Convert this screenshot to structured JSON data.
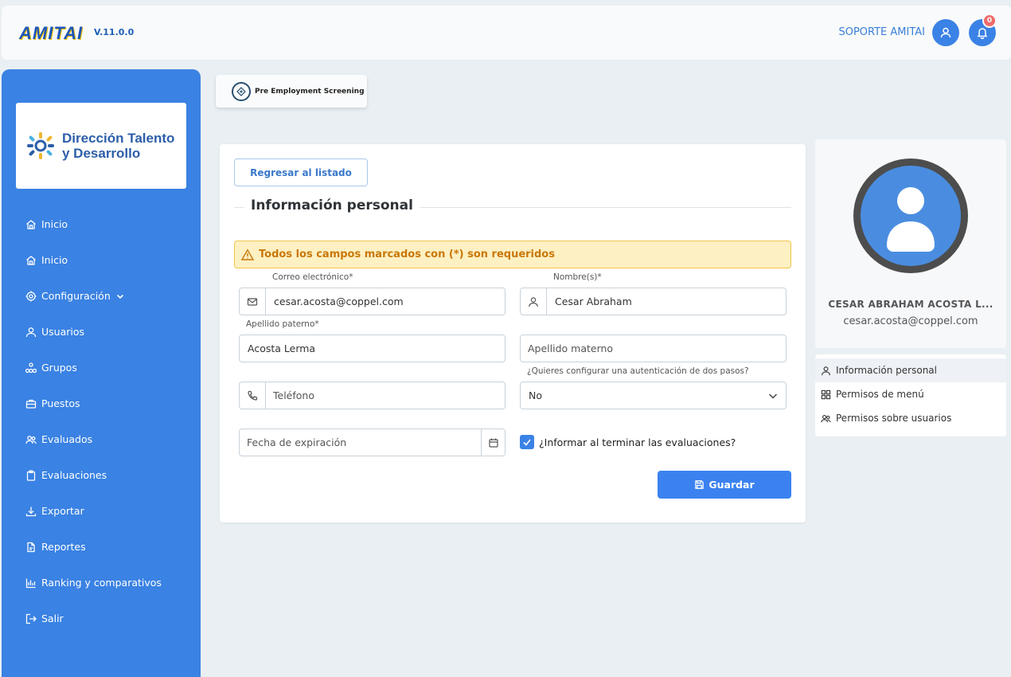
{
  "header": {
    "brand": "AMITAI",
    "version": "V.11.0.0",
    "support_label": "SOPORTE AMITAI",
    "notification_count": "0"
  },
  "sidebar": {
    "org_name_line1": "Dirección Talento",
    "org_name_line2": "y Desarrollo",
    "items": [
      {
        "label": "Inicio",
        "icon": "home-icon"
      },
      {
        "label": "Inicio",
        "icon": "home-icon"
      },
      {
        "label": "Configuración",
        "icon": "gear-icon"
      },
      {
        "label": "Usuarios",
        "icon": "user-icon"
      },
      {
        "label": "Grupos",
        "icon": "sitemap-icon"
      },
      {
        "label": "Puestos",
        "icon": "briefcase-icon"
      },
      {
        "label": "Evaluados",
        "icon": "users-icon"
      },
      {
        "label": "Evaluaciones",
        "icon": "clipboard-icon"
      },
      {
        "label": "Exportar",
        "icon": "download-icon"
      },
      {
        "label": "Reportes",
        "icon": "file-icon"
      },
      {
        "label": "Ranking y comparativos",
        "icon": "bar-chart-icon"
      },
      {
        "label": "Salir",
        "icon": "logout-icon"
      }
    ]
  },
  "module": {
    "label": "Pre Employment Screening"
  },
  "form": {
    "back_label": "Regresar al listado",
    "section_title": "Información personal",
    "alert": "Todos los campos marcados con (*) son requeridos",
    "email_label": "Correo electrónico*",
    "email_value": "cesar.acosta@coppel.com",
    "name_label": "Nombre(s)*",
    "name_value": "Cesar Abraham",
    "lastname1_label": "Apellido paterno*",
    "lastname1_value": "Acosta Lerma",
    "lastname2_placeholder": "Apellido materno",
    "twofa_label": "¿Quieres configurar una autenticación de dos pasos?",
    "twofa_value": "No",
    "phone_placeholder": "Teléfono",
    "expiration_placeholder": "Fecha de expiración",
    "notify_label": "¿Informar al terminar las evaluaciones?",
    "save_label": "Guardar"
  },
  "profile": {
    "name": "CESAR ABRAHAM ACOSTA L...",
    "email": "cesar.acosta@coppel.com"
  },
  "profile_menu": [
    {
      "label": "Información personal",
      "icon": "user-icon"
    },
    {
      "label": "Permisos de menú",
      "icon": "grid-icon"
    },
    {
      "label": "Permisos sobre usuarios",
      "icon": "users-icon"
    }
  ],
  "colors": {
    "primary": "#3a82e3",
    "button": "#3b82f0",
    "alert_bg": "#fdf0c2",
    "alert_text": "#c97708",
    "badge": "#ef6b6b"
  }
}
